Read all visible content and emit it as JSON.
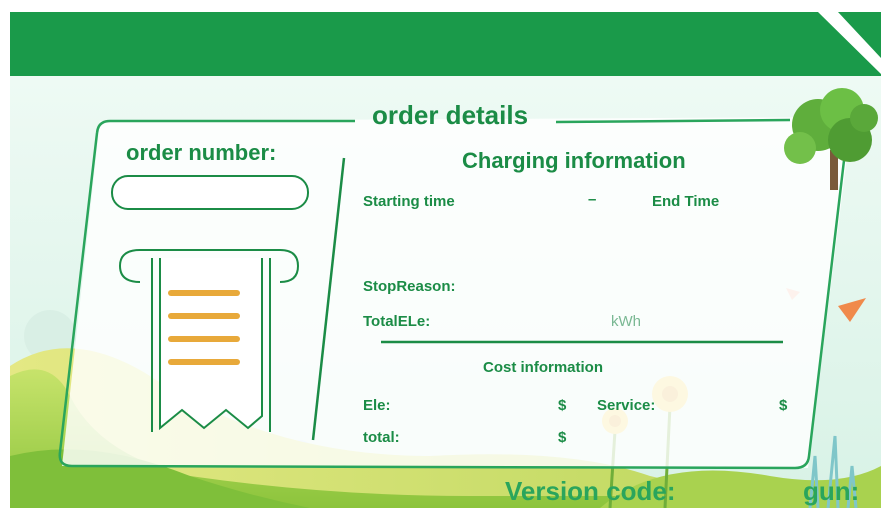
{
  "title": "order details",
  "order": {
    "label": "order number:"
  },
  "charging": {
    "title": "Charging information",
    "starting_time": "Starting time",
    "separator": "–",
    "end_time": "End Time",
    "stop_reason": "StopReason:",
    "total_ele": "TotalELe:",
    "unit": "kWh"
  },
  "cost": {
    "title": "Cost information",
    "ele": "Ele:",
    "ele_currency": "$",
    "service": "Service:",
    "service_currency": "$",
    "total": "total:",
    "total_currency": "$"
  },
  "footer": {
    "version": "Version code:",
    "gun": "gun:"
  },
  "colors": {
    "primary_green": "#1a9a4a",
    "text_green": "#1b8c46",
    "accent_orange": "#e8a93a"
  }
}
